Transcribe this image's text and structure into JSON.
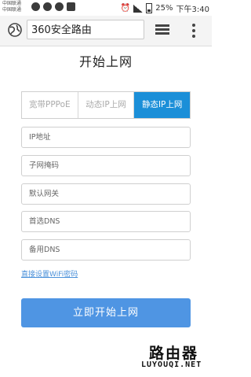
{
  "statusbar": {
    "carrier1": "中国联通",
    "carrier2": "中国联通",
    "battery": "25%",
    "time": "下午3:40"
  },
  "browser": {
    "url_text": "360安全路由"
  },
  "page": {
    "title": "开始上网",
    "modes": [
      "宽带PPPoE",
      "动态IP上网",
      "静态IP上网"
    ],
    "selected_mode": "静态IP上网",
    "fields": {
      "ip": "IP地址",
      "mask": "子网掩码",
      "gateway": "默认网关",
      "dns1": "首选DNS",
      "dns2": "备用DNS"
    },
    "wifi_link": "直接设置WiFi密码",
    "start_button": "立即开始上网"
  },
  "watermark": {
    "line1": "路由器",
    "line2": "LUYOUQI.NET"
  },
  "colors": {
    "accent": "#1b8fd8",
    "button": "#4f95e3",
    "link": "#4a90d9"
  }
}
